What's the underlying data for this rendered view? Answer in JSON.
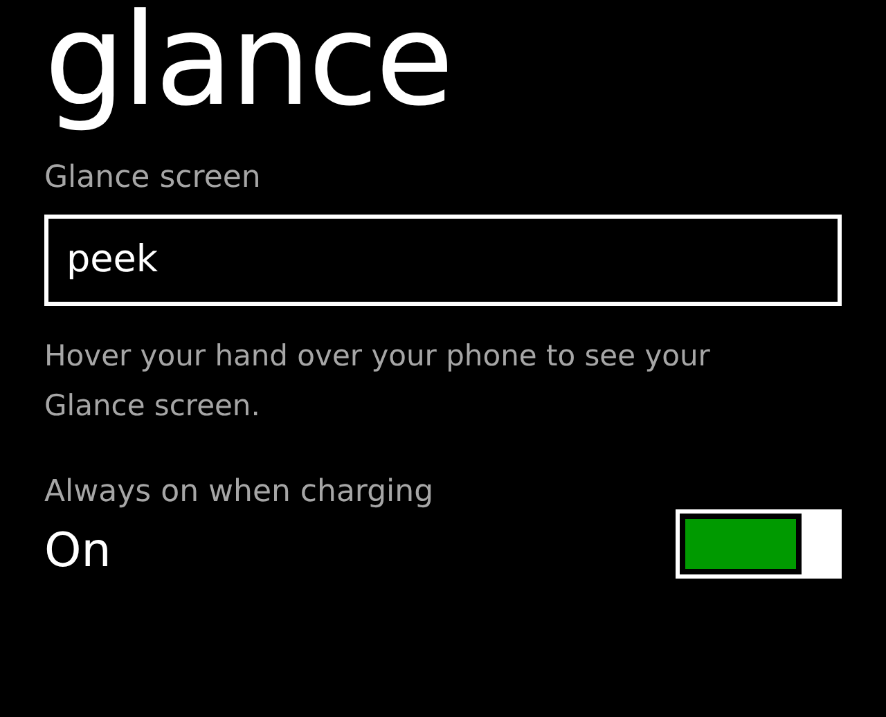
{
  "title": "glance",
  "glance_screen": {
    "label": "Glance screen",
    "value": "peek",
    "description": "Hover your hand over your phone to see your Glance screen."
  },
  "always_on": {
    "label": "Always on when charging",
    "state_text": "On",
    "on": true
  }
}
